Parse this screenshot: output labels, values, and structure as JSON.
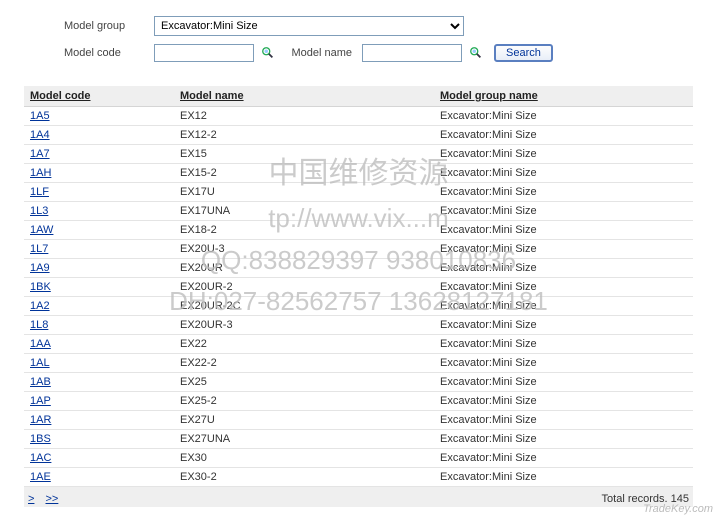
{
  "search": {
    "model_group_label": "Model group",
    "model_group_value": "Excavator:Mini Size",
    "model_code_label": "Model code",
    "model_code_value": "",
    "model_name_label": "Model name",
    "model_name_value": "",
    "search_button": "Search"
  },
  "table": {
    "headers": {
      "code": "Model code",
      "name": "Model name",
      "group": "Model group name"
    },
    "rows": [
      {
        "code": "1A5",
        "name": "EX12",
        "group": "Excavator:Mini Size"
      },
      {
        "code": "1A4",
        "name": "EX12-2",
        "group": "Excavator:Mini Size"
      },
      {
        "code": "1A7",
        "name": "EX15",
        "group": "Excavator:Mini Size"
      },
      {
        "code": "1AH",
        "name": "EX15-2",
        "group": "Excavator:Mini Size"
      },
      {
        "code": "1LF",
        "name": "EX17U",
        "group": "Excavator:Mini Size"
      },
      {
        "code": "1L3",
        "name": "EX17UNA",
        "group": "Excavator:Mini Size"
      },
      {
        "code": "1AW",
        "name": "EX18-2",
        "group": "Excavator:Mini Size"
      },
      {
        "code": "1L7",
        "name": "EX20U-3",
        "group": "Excavator:Mini Size"
      },
      {
        "code": "1A9",
        "name": "EX20UR",
        "group": "Excavator:Mini Size"
      },
      {
        "code": "1BK",
        "name": "EX20UR-2",
        "group": "Excavator:Mini Size"
      },
      {
        "code": "1A2",
        "name": "EX20UR-2C",
        "group": "Excavator:Mini Size"
      },
      {
        "code": "1L8",
        "name": "EX20UR-3",
        "group": "Excavator:Mini Size"
      },
      {
        "code": "1AA",
        "name": "EX22",
        "group": "Excavator:Mini Size"
      },
      {
        "code": "1AL",
        "name": "EX22-2",
        "group": "Excavator:Mini Size"
      },
      {
        "code": "1AB",
        "name": "EX25",
        "group": "Excavator:Mini Size"
      },
      {
        "code": "1AP",
        "name": "EX25-2",
        "group": "Excavator:Mini Size"
      },
      {
        "code": "1AR",
        "name": "EX27U",
        "group": "Excavator:Mini Size"
      },
      {
        "code": "1BS",
        "name": "EX27UNA",
        "group": "Excavator:Mini Size"
      },
      {
        "code": "1AC",
        "name": "EX30",
        "group": "Excavator:Mini Size"
      },
      {
        "code": "1AE",
        "name": "EX30-2",
        "group": "Excavator:Mini Size"
      }
    ]
  },
  "footer": {
    "pager_next": ">",
    "pager_last": ">>",
    "total_label": "Total records.",
    "total_count": "145"
  },
  "watermark": {
    "line1": "中国维修资源",
    "line2": "tp://www.vix...m",
    "line3": "QQ:838829397 938010836",
    "line4": "DH:027-82562757 13628127181"
  },
  "site_mark": "TradeKey.com"
}
